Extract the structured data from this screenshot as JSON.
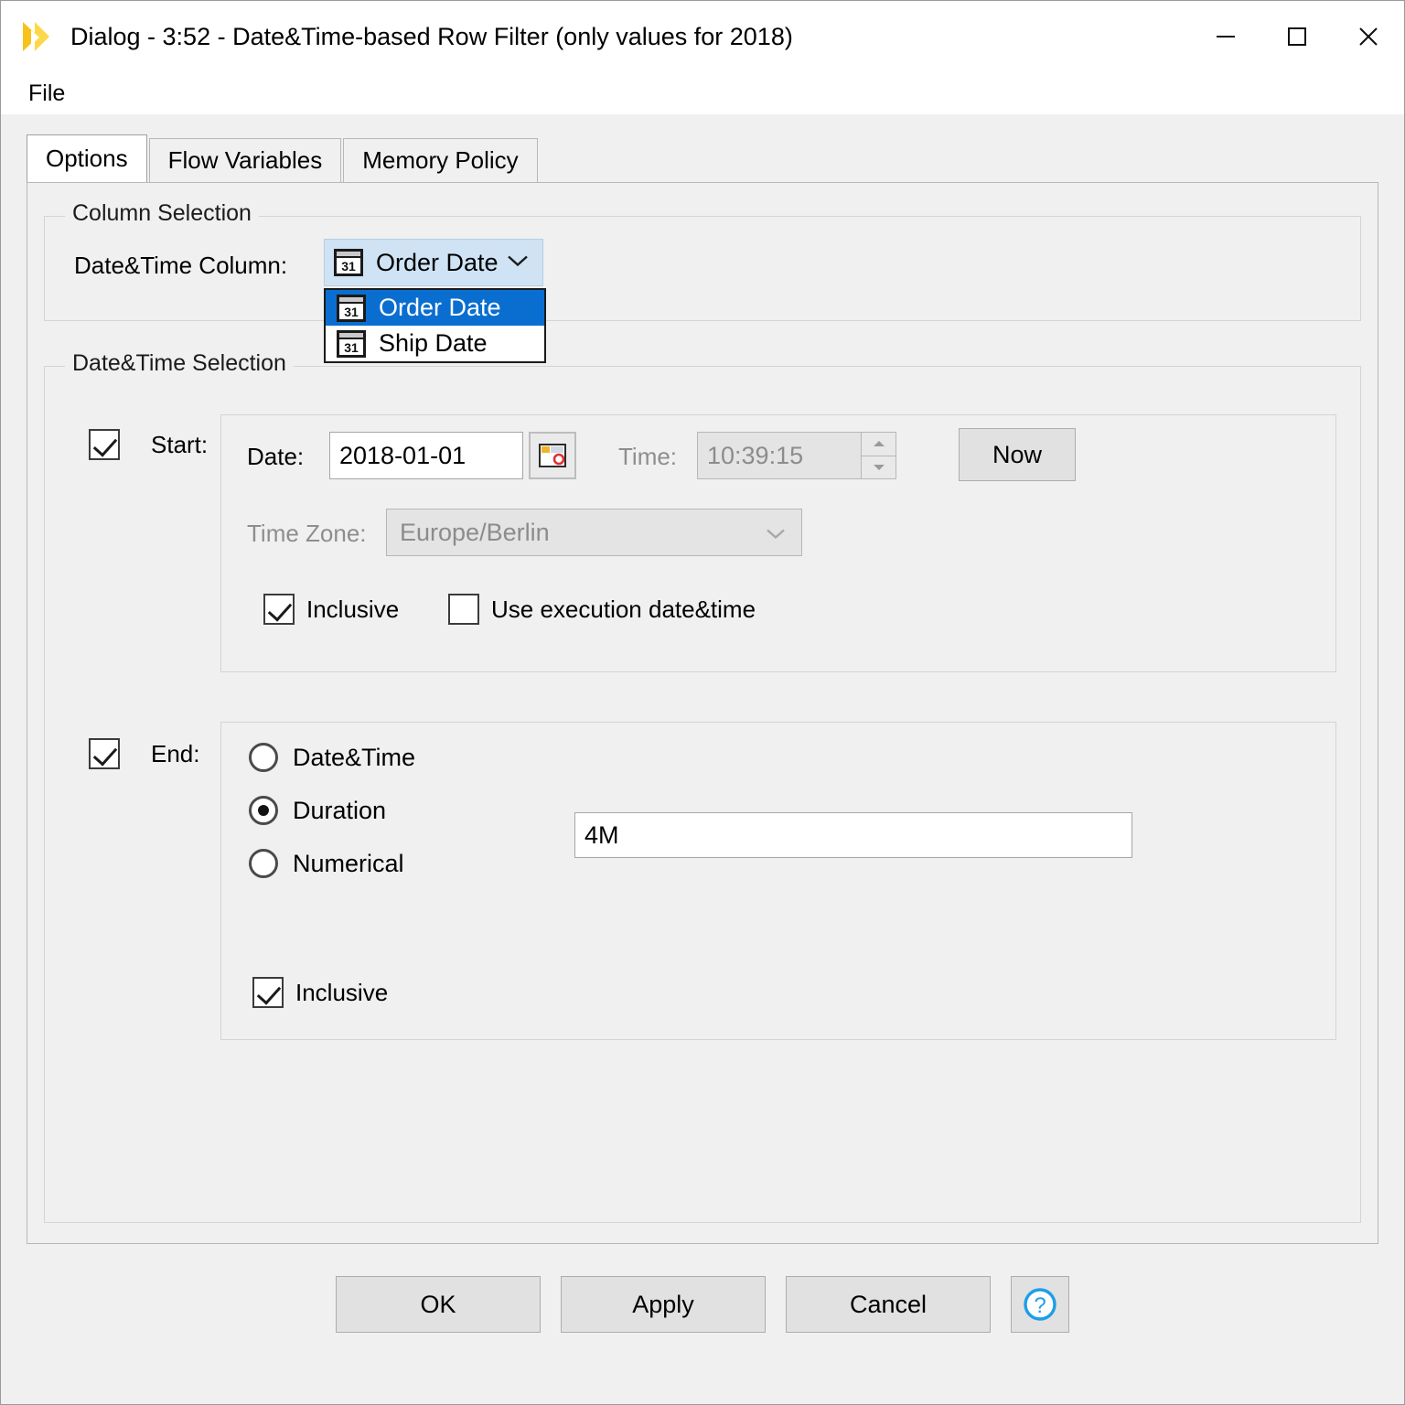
{
  "window": {
    "title": "Dialog - 3:52 - Date&Time-based Row Filter (only values for 2018)",
    "icon": "knime-triangle-icon",
    "controls": {
      "minimize": "minimize-icon",
      "maximize": "maximize-icon",
      "close": "close-icon"
    }
  },
  "menubar": {
    "items": [
      {
        "label": "File"
      }
    ]
  },
  "tabs": [
    {
      "label": "Options",
      "active": true
    },
    {
      "label": "Flow Variables",
      "active": false
    },
    {
      "label": "Memory Policy",
      "active": false
    }
  ],
  "column_selection": {
    "group_label": "Column Selection",
    "field_label": "Date&Time Column:",
    "selected_value": "Order Date",
    "icon": "calendar-31-icon",
    "dropdown_open": true,
    "options": [
      {
        "label": "Order Date",
        "selected": true,
        "icon": "calendar-31-icon"
      },
      {
        "label": "Ship Date",
        "selected": false,
        "icon": "calendar-31-icon"
      }
    ]
  },
  "datetime_selection": {
    "group_label": "Date&Time Selection",
    "start": {
      "label": "Start:",
      "enabled": true,
      "date_label": "Date:",
      "date_value": "2018-01-01",
      "date_picker_icon": "calendar-picker-icon",
      "time_label": "Time:",
      "time_value": "10:39:15",
      "time_enabled": false,
      "spinner_icon": "spinner-up-down-icon",
      "now_button": "Now",
      "timezone_label": "Time Zone:",
      "timezone_value": "Europe/Berlin",
      "timezone_enabled": false,
      "inclusive_label": "Inclusive",
      "inclusive_checked": true,
      "execution_label": "Use execution date&time",
      "execution_checked": false
    },
    "end": {
      "label": "End:",
      "enabled": true,
      "modes": [
        {
          "label": "Date&Time",
          "selected": false
        },
        {
          "label": "Duration",
          "selected": true
        },
        {
          "label": "Numerical",
          "selected": false
        }
      ],
      "duration_value": "4M",
      "inclusive_label": "Inclusive",
      "inclusive_checked": true
    }
  },
  "footer": {
    "ok": "OK",
    "apply": "Apply",
    "cancel": "Cancel",
    "help_icon": "help-question-icon"
  },
  "colors": {
    "accent_highlight": "#0a6ed1",
    "combo_background": "#cfe3f5",
    "dialog_background": "#f0f0f0",
    "knime_yellow": "#f9c21a",
    "help_blue": "#1e9ee8"
  }
}
